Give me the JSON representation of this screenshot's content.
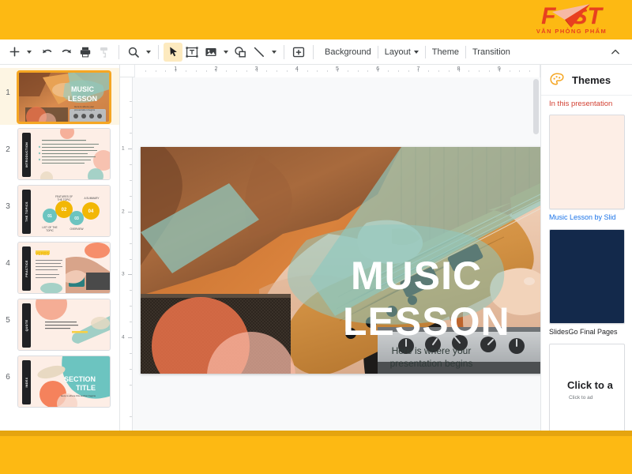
{
  "brand": {
    "name": "FAST",
    "name_part1": "F",
    "name_part2": "ST",
    "subtitle": "VĂN PHÒNG PHẨM",
    "logo_color": "#e8401f",
    "background_color": "#fdb913"
  },
  "toolbar": {
    "icons": [
      {
        "name": "new-slide-icon",
        "glyph": "+"
      },
      {
        "name": "undo-icon",
        "glyph": "↶"
      },
      {
        "name": "redo-icon",
        "glyph": "↷"
      },
      {
        "name": "print-icon",
        "glyph": "🖶"
      },
      {
        "name": "paint-format-icon",
        "glyph": "⌐"
      },
      {
        "name": "zoom-icon",
        "glyph": "🔍"
      },
      {
        "name": "select-cursor-icon",
        "glyph": "➤"
      },
      {
        "name": "text-box-icon",
        "glyph": "T"
      },
      {
        "name": "insert-image-icon",
        "glyph": "▤"
      },
      {
        "name": "shape-icon",
        "glyph": "◯"
      },
      {
        "name": "line-icon",
        "glyph": "╲"
      },
      {
        "name": "add-comment-icon",
        "glyph": "✚"
      }
    ],
    "background_label": "Background",
    "layout_label": "Layout",
    "theme_label": "Theme",
    "transition_label": "Transition",
    "collapse_label": "collapse-toolbar"
  },
  "ruler": {
    "horizontal_marks": [
      "1",
      "2",
      "3",
      "4",
      "5",
      "6",
      "7",
      "8",
      "9"
    ],
    "vertical_marks": [
      "1",
      "2",
      "3",
      "4"
    ],
    "unit": "inches"
  },
  "filmstrip": {
    "slides": [
      {
        "number": "1",
        "title": "MUSIC LESSON",
        "selected": true,
        "side_label": "MUSIC LESSON"
      },
      {
        "number": "2",
        "title": "",
        "selected": false,
        "side_label": "INTRODUCTION"
      },
      {
        "number": "3",
        "title": "",
        "selected": false,
        "side_label": "THE TOPICS"
      },
      {
        "number": "4",
        "title": "VERBS",
        "selected": false,
        "side_label": "PRACTICE"
      },
      {
        "number": "5",
        "title": "",
        "selected": false,
        "side_label": "QUOTE"
      },
      {
        "number": "6",
        "title": "SECTION TITLE",
        "selected": false,
        "side_label": "INDEX"
      }
    ],
    "slide3_circles": [
      {
        "label": "01",
        "color": "#6cc4c0"
      },
      {
        "label": "02",
        "color": "#f2b705"
      },
      {
        "label": "03",
        "color": "#6cc4c0"
      },
      {
        "label": "04",
        "color": "#f2b705"
      }
    ]
  },
  "slide": {
    "title_line1": "MUSIC",
    "title_line2": "LESSON",
    "subtitle_line1": "Here is where your",
    "subtitle_line2": "presentation begins",
    "accent_teal": "#8fc9bf",
    "accent_orange": "#f4764c",
    "title_color": "#ffffff"
  },
  "panel": {
    "title": "Themes",
    "icon": "palette-icon",
    "subheading": "In this presentation",
    "themes": [
      {
        "name": "Music Lesson by Slid",
        "color": "#fdeee6",
        "type": "pink"
      },
      {
        "name": "SlidesGo Final Pages",
        "color": "#13294b",
        "type": "navy"
      },
      {
        "name": "",
        "color": "#ffffff",
        "type": "blank",
        "blank_title": "Click to a",
        "blank_subtitle": "Click to ad"
      }
    ]
  }
}
